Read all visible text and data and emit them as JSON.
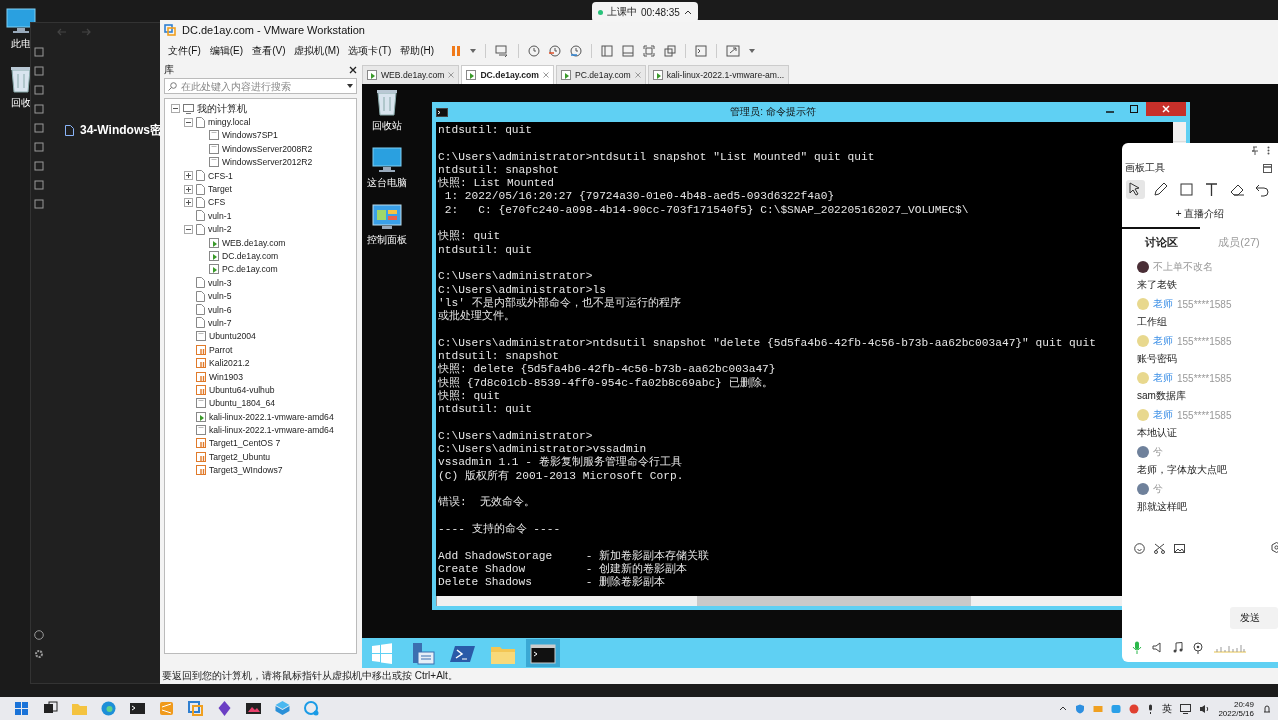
{
  "desktop": {
    "icons": [
      {
        "label": "此电",
        "kind": "pc"
      },
      {
        "label": "回收",
        "kind": "recycle"
      }
    ]
  },
  "class_timer": {
    "status": "上课中",
    "time": "00:48:35"
  },
  "background_window": {
    "title": "34-Windows密"
  },
  "vmware": {
    "title": "DC.de1ay.com - VMware Workstation",
    "menu": [
      "文件(F)",
      "编辑(E)",
      "查看(V)",
      "虚拟机(M)",
      "选项卡(T)",
      "帮助(H)"
    ],
    "library": {
      "title": "库",
      "search": {
        "placeholder": "在此处键入内容进行搜索"
      },
      "tree": [
        {
          "label": "我的计算机",
          "kind": "computer",
          "expanded": true,
          "children": [
            {
              "label": "mingy.local",
              "kind": "folder",
              "expanded": true,
              "children": [
                {
                  "label": "Windows7SP1",
                  "kind": "vm"
                },
                {
                  "label": "WindowsServer2008R2",
                  "kind": "vm"
                },
                {
                  "label": "WindowsServer2012R2",
                  "kind": "vm"
                }
              ]
            },
            {
              "label": "CFS-1",
              "kind": "folder",
              "expanded": false
            },
            {
              "label": "Target",
              "kind": "folder",
              "expanded": false
            },
            {
              "label": "CFS",
              "kind": "folder",
              "expanded": false
            },
            {
              "label": "vuln-1",
              "kind": "folder"
            },
            {
              "label": "vuln-2",
              "kind": "folder",
              "expanded": true,
              "children": [
                {
                  "label": "WEB.de1ay.com",
                  "kind": "running"
                },
                {
                  "label": "DC.de1ay.com",
                  "kind": "running"
                },
                {
                  "label": "PC.de1ay.com",
                  "kind": "running"
                }
              ]
            },
            {
              "label": "vuln-3",
              "kind": "folder"
            },
            {
              "label": "vuln-5",
              "kind": "folder"
            },
            {
              "label": "vuln-6",
              "kind": "folder"
            },
            {
              "label": "vuln-7",
              "kind": "folder"
            },
            {
              "label": "Ubuntu2004",
              "kind": "vm"
            },
            {
              "label": "Parrot",
              "kind": "paused"
            },
            {
              "label": "Kali2021.2",
              "kind": "paused"
            },
            {
              "label": "Win1903",
              "kind": "paused"
            },
            {
              "label": "Ubuntu64-vulhub",
              "kind": "paused"
            },
            {
              "label": "Ubuntu_1804_64",
              "kind": "vm"
            },
            {
              "label": "kali-linux-2022.1-vmware-amd64",
              "kind": "running"
            },
            {
              "label": "kali-linux-2022.1-vmware-amd64",
              "kind": "vm"
            },
            {
              "label": "Target1_CentOS 7",
              "kind": "paused"
            },
            {
              "label": "Target2_Ubuntu",
              "kind": "paused"
            },
            {
              "label": "Target3_WIndows7",
              "kind": "paused"
            }
          ]
        }
      ]
    },
    "tabs": [
      {
        "label": "WEB.de1ay.com",
        "selected": false
      },
      {
        "label": "DC.de1ay.com",
        "selected": true
      },
      {
        "label": "PC.de1ay.com",
        "selected": false
      },
      {
        "label": "kali-linux-2022.1-vmware-am...",
        "selected": false
      }
    ],
    "guest": {
      "desktop_icons": [
        {
          "label": "回收站",
          "kind": "recycle"
        },
        {
          "label": "这台电脑",
          "kind": "pc"
        },
        {
          "label": "控制面板",
          "kind": "control"
        }
      ],
      "terminal": {
        "title": "管理员: 命令提示符",
        "blocks": [
          [
            "ntdsutil: quit"
          ],
          [
            "C:\\Users\\administrator>ntdsutil snapshot \"List Mounted\" quit quit",
            "ntdsutil: snapshot",
            "快照: List Mounted",
            " 1: 2022/05/16:20:27 {79724a30-01e0-4b48-aed5-093d6322f4a0}",
            " 2:   C: {e70fc240-a098-4b14-90cc-703f171540f5} C:\\$SNAP_202205162027_VOLUMEC$\\"
          ],
          [
            "快照: quit",
            "ntdsutil: quit"
          ],
          [
            "C:\\Users\\administrator>",
            "C:\\Users\\administrator>ls",
            "'ls' 不是内部或外部命令，也不是可运行的程序",
            "或批处理文件。"
          ],
          [
            "C:\\Users\\administrator>ntdsutil snapshot \"delete {5d5fa4b6-42fb-4c56-b73b-aa62bc003a47}\" quit quit",
            "ntdsutil: snapshot",
            "快照: delete {5d5fa4b6-42fb-4c56-b73b-aa62bc003a47}",
            "快照 {7d8c01cb-8539-4ff0-954c-fa02b8c69abc} 已删除。",
            "快照: quit",
            "ntdsutil: quit"
          ],
          [
            "C:\\Users\\administrator>",
            "C:\\Users\\administrator>vssadmin",
            "vssadmin 1.1 - 卷影复制服务管理命令行工具",
            "(C) 版权所有 2001-2013 Microsoft Corp."
          ],
          [
            "错误:  无效命令。"
          ],
          [
            "---- 支持的命令 ----"
          ],
          [
            "Add ShadowStorage     - 新加卷影副本存储关联",
            "Create Shadow         - 创建新的卷影副本",
            "Delete Shadows        - 删除卷影副本"
          ]
        ]
      },
      "taskbar": [
        {
          "kind": "start",
          "active": false
        },
        {
          "kind": "server",
          "active": false
        },
        {
          "kind": "powershell",
          "active": false
        },
        {
          "kind": "explorer",
          "active": false
        },
        {
          "kind": "cmd",
          "active": true
        }
      ]
    },
    "status_bar": "要返回到您的计算机，请将鼠标指针从虚拟机中移出或按 Ctrl+Alt。"
  },
  "chat": {
    "title": "画板工具",
    "tools": [
      {
        "kind": "select",
        "selected": true
      },
      {
        "kind": "pen",
        "selected": false
      },
      {
        "kind": "rect",
        "selected": false
      },
      {
        "kind": "text",
        "selected": false
      },
      {
        "kind": "eraser",
        "selected": false
      },
      {
        "kind": "undo",
        "selected": false
      }
    ],
    "intro": "+ 直播介绍",
    "tabs": [
      {
        "label": "讨论区",
        "selected": true
      },
      {
        "label": "成员(27)",
        "selected": false
      }
    ],
    "messages": [
      {
        "color": "#4a2e36",
        "name": "不上单不改名",
        "text": "来了老铁"
      },
      {
        "color": "#e8d88e",
        "badge": "老师",
        "name": "155****1585",
        "text": "工作组"
      },
      {
        "color": "#e8d88e",
        "badge": "老师",
        "name": "155****1585",
        "text": "账号密码"
      },
      {
        "color": "#e8d88e",
        "badge": "老师",
        "name": "155****1585",
        "text": "sam数据库"
      },
      {
        "color": "#e8d88e",
        "badge": "老师",
        "name": "155****1585",
        "text": "本地认证"
      },
      {
        "color": "#6f819b",
        "name": "兮",
        "text": "老师，字体放大点吧"
      },
      {
        "color": "#6f819b",
        "name": "兮",
        "text": "那就这样吧"
      }
    ],
    "send": "发送"
  },
  "taskbar": {
    "input_method": "英",
    "time": "20:49",
    "date": "2022/5/16"
  }
}
